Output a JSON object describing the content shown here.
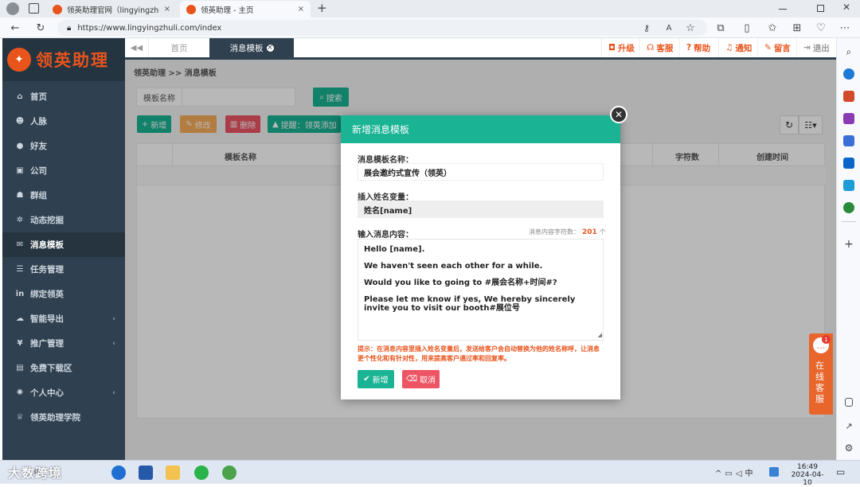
{
  "browser": {
    "tabs": [
      {
        "title": "领英助理官网（lingyingzhuli.com",
        "close": "×"
      },
      {
        "title": "领英助理 - 主页",
        "close": "×"
      }
    ],
    "new_tab": "+",
    "url": "https://www.lingyingzhuli.com/index"
  },
  "app": {
    "logo_text": "领英助理",
    "sidebar": {
      "items": [
        {
          "label": "首页",
          "icon": "home-icon"
        },
        {
          "label": "人脉",
          "icon": "users-icon"
        },
        {
          "label": "好友",
          "icon": "chat-icon"
        },
        {
          "label": "公司",
          "icon": "briefcase-icon"
        },
        {
          "label": "群组",
          "icon": "group-icon"
        },
        {
          "label": "动态挖掘",
          "icon": "gear-icon"
        },
        {
          "label": "消息模板",
          "icon": "envelope-icon"
        },
        {
          "label": "任务管理",
          "icon": "list-icon"
        },
        {
          "label": "绑定领英",
          "icon": "linkedin-icon"
        },
        {
          "label": "智能导出",
          "icon": "cloud-download-icon"
        },
        {
          "label": "推广管理",
          "icon": "yen-icon"
        },
        {
          "label": "免费下载区",
          "icon": "file-icon"
        },
        {
          "label": "个人中心",
          "icon": "cog-icon"
        },
        {
          "label": "领英助理学院",
          "icon": "graduation-cap-icon"
        }
      ]
    },
    "topnav": {
      "tabs": [
        {
          "label": "首页"
        },
        {
          "label": "消息模板"
        }
      ],
      "right_links": [
        {
          "label": "升级",
          "icon": "upgrade-icon"
        },
        {
          "label": "客服",
          "icon": "headset-icon"
        },
        {
          "label": "帮助",
          "icon": "help-icon"
        },
        {
          "label": "通知",
          "icon": "bell-icon"
        },
        {
          "label": "留言",
          "icon": "edit-icon"
        },
        {
          "label": "退出",
          "icon": "logout-icon"
        }
      ]
    },
    "breadcrumb": "领英助理 >> 消息模板",
    "search": {
      "label": "模板名称",
      "button": "搜索"
    },
    "toolbar": {
      "add": "新增",
      "edit": "修改",
      "delete": "删除",
      "hint": "提醒：领英添加"
    },
    "table": {
      "columns": [
        "模板名称",
        "字符数",
        "创建时间"
      ]
    }
  },
  "modal": {
    "title": "新增消息模板",
    "name_label": "消息模板名称：",
    "name_value": "展会邀约式宣传（领英）",
    "var_label": "插入姓名变量：",
    "var_value": "姓名[name]",
    "content_label": "输入消息内容：",
    "char_count_prefix": "消息内容字符数：",
    "char_count": "201",
    "char_count_suffix": "个",
    "content_lines": [
      "Hello [name].",
      "We haven't seen each other for a while.",
      "Would you like to going to #展会名称+时间#?",
      "Please let me know if yes, We hereby sincerely invite you to visit our booth#展位号"
    ],
    "tip": "提示：在消息内容里插入姓名变量后，发送给客户会自动替换为他的姓名称呼，让消息更个性化和有针对性，用来提高客户通过率和回复率。",
    "submit": "新增",
    "cancel": "取消"
  },
  "chat_widget": {
    "badge": "1",
    "label": "在线客服"
  },
  "taskbar": {
    "time": "16:49",
    "date": "2024-04-10",
    "watermark": "大数跨境"
  },
  "colors": {
    "primary": "#1ab394",
    "accent": "#e8541c",
    "sidebar": "#2f4050",
    "danger": "#ed5565",
    "warning": "#f8ac59"
  }
}
